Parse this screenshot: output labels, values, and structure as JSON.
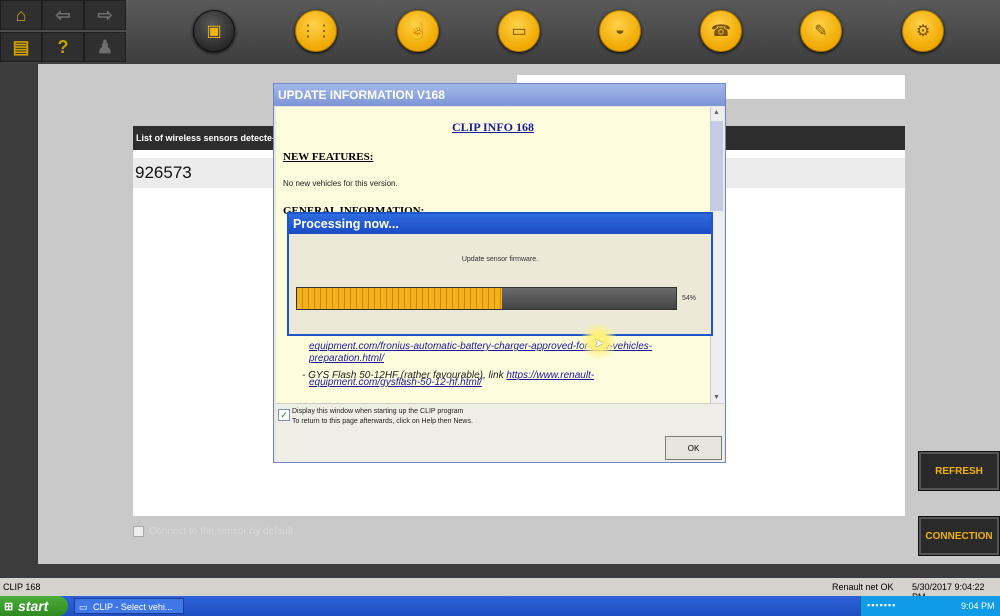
{
  "toolbar": {
    "nav": [
      "home",
      "back",
      "forward",
      "print",
      "help",
      "user-car"
    ],
    "help_label": "?",
    "round_icons": [
      "car-diagnostic-icon",
      "gearbox-icon",
      "touch-hand-icon",
      "ecu-icon",
      "vehicle-part-icon",
      "phone-support-icon",
      "wrench-icon",
      "car-settings-icon"
    ]
  },
  "main": {
    "list_header": "List of wireless sensors detecte-",
    "sensor_id": "926573",
    "checkbox_label": "Connect to the sensor by default",
    "refresh_label": "REFRESH",
    "connection_label": "CONNECTION"
  },
  "update_dialog": {
    "title": "UPDATE INFORMATION V168",
    "heading": "CLIP INFO 168",
    "new_features": "NEW FEATURES:",
    "no_new_vehicles": "No new vehicles for this version.",
    "general_info": "GENERAL INFORMATION:",
    "link1_line1": "equipment.com/fronius-automatic-battery-charger-approved-for-new-vehicles-",
    "link1_line2": "preparation.html/",
    "item2_text": "- GYS Flash 50-12HF (rather favourable), link ",
    "item2_link": "https://www.renault-",
    "link2_line2": "equipment.com/gysflash-50-12-hf.html/",
    "display_checkbox": "Display this window when starting up the CLIP program",
    "return_note": "To return to this page afterwards, click on Help then News.",
    "ok_label": "OK"
  },
  "processing_dialog": {
    "title": "Processing now...",
    "message": "Update sensor firmware.",
    "progress_percent": 54,
    "progress_label": "54%"
  },
  "statusbar": {
    "app_version": "CLIP 168",
    "network_status": "Renault net OK",
    "datetime": "5/30/2017 9:04:22 PM"
  },
  "taskbar": {
    "start_label": "start",
    "task_item": "CLIP - Select vehi...",
    "clock": "9:04 PM"
  },
  "colors": {
    "accent_yellow": "#f0b400",
    "dialog_title_blue": "#1b4bc2",
    "progress_fill": "#f3b21a"
  }
}
